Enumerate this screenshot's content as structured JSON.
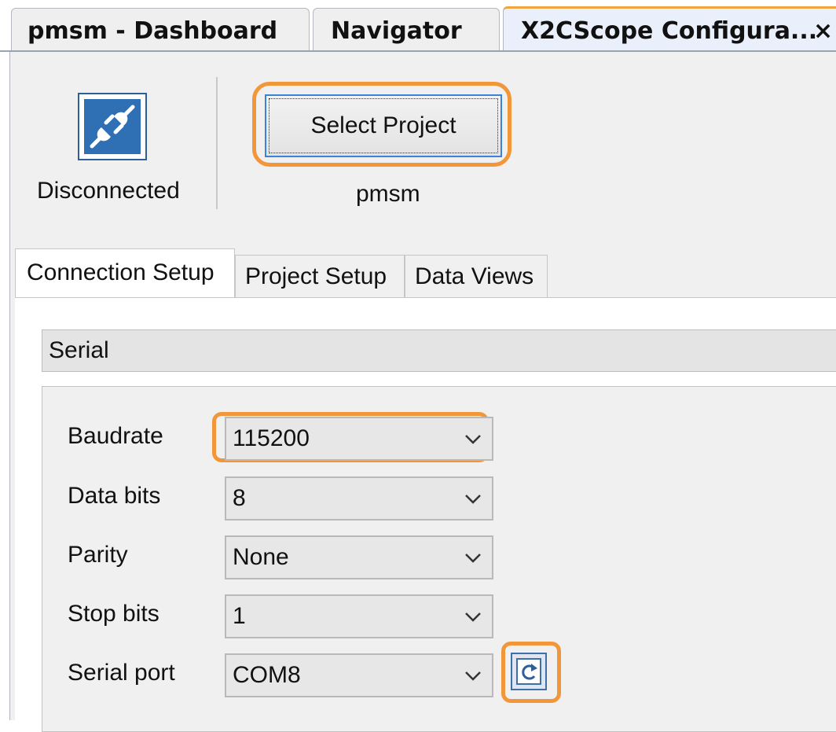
{
  "doc_tabs": {
    "dashboard": "pmsm - Dashboard",
    "navigator": "Navigator",
    "x2cscope": "X2CScope Configura...",
    "close_glyph": "×"
  },
  "toolbar": {
    "status_label": "Disconnected",
    "status_icon": "disconnected-plug-icon",
    "select_project_label": "Select Project",
    "project_name": "pmsm"
  },
  "inner_tabs": {
    "connection": "Connection Setup",
    "project": "Project Setup",
    "data_views": "Data Views",
    "active": "Connection Setup"
  },
  "connection": {
    "type": "Serial",
    "fields": [
      {
        "label": "Baudrate",
        "value": "115200"
      },
      {
        "label": "Data bits",
        "value": "8"
      },
      {
        "label": "Parity",
        "value": "None"
      },
      {
        "label": "Stop bits",
        "value": "1"
      },
      {
        "label": "Serial port",
        "value": "COM8"
      }
    ],
    "refresh_icon": "refresh-icon"
  },
  "colors": {
    "highlight": "#f2963a",
    "active_tab_accent": "#f2a53c",
    "icon_blue": "#2f6fb4"
  }
}
